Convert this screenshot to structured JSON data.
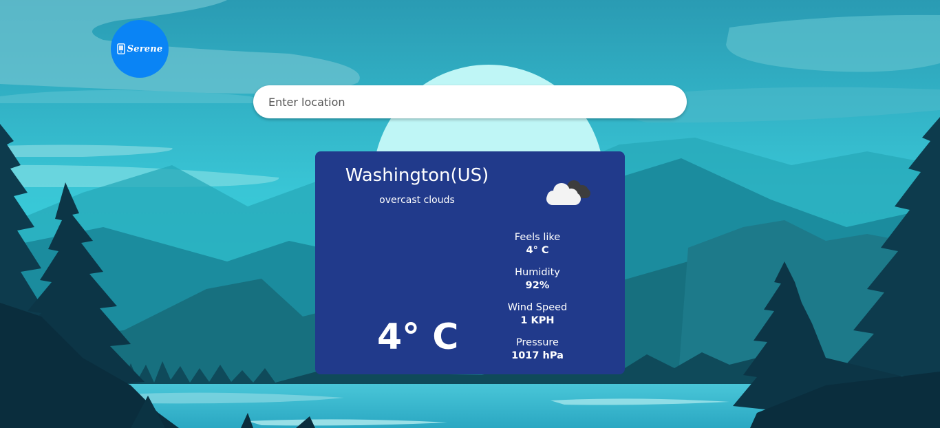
{
  "brand": {
    "name": "Serene",
    "logo_icon": "phone-icon",
    "color": "#0a84f5"
  },
  "search": {
    "placeholder": "Enter location",
    "value": ""
  },
  "weather": {
    "city": "Washington(US)",
    "description": "overcast clouds",
    "icon": "overcast-clouds-icon",
    "temperature": "4° C",
    "card_color": "#213a8b",
    "stats": [
      {
        "label": "Feels like",
        "value": "4° C"
      },
      {
        "label": "Humidity",
        "value": "92%"
      },
      {
        "label": "Wind Speed",
        "value": "1 KPH"
      },
      {
        "label": "Pressure",
        "value": "1017 hPa"
      }
    ]
  }
}
